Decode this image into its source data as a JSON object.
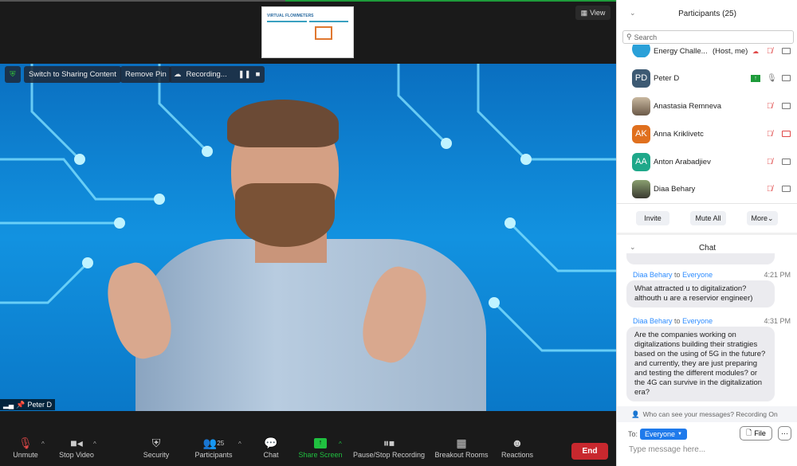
{
  "share_thumbnail": {
    "title": "VIRTUAL FLOWMETERS"
  },
  "view_button": "View",
  "video_overlay": {
    "switch_label": "Switch to Sharing Content",
    "remove_pin_label": "Remove Pin",
    "recording_label": "Recording...",
    "pause_icon": "pause-icon",
    "stop_icon": "stop-icon"
  },
  "active_speaker": {
    "name": "Peter D"
  },
  "toolbar": {
    "unmute": "Unmute",
    "stop_video": "Stop Video",
    "security": "Security",
    "participants": "Participants",
    "participants_count": "25",
    "chat": "Chat",
    "share_screen": "Share Screen",
    "recording": "Pause/Stop Recording",
    "breakout": "Breakout Rooms",
    "reactions": "Reactions",
    "end": "End"
  },
  "participants_panel": {
    "title": "Participants (25)",
    "search_placeholder": "Search",
    "items": [
      {
        "name": "Energy Challe...",
        "role": "(Host, me)",
        "mic": "muted",
        "video": "on",
        "avatar": "logo"
      },
      {
        "name": "Peter D",
        "initials": "PD",
        "mic": "on",
        "video": "on",
        "sharing": true,
        "color": "#3d5a73"
      },
      {
        "name": "Anastasia Remneva",
        "mic": "muted",
        "video": "on",
        "avatar": "photo"
      },
      {
        "name": "Anna Kriklivetc",
        "initials": "AK",
        "mic": "muted",
        "video": "off",
        "color": "#e0701e"
      },
      {
        "name": "Anton Arabadjiev",
        "initials": "AA",
        "mic": "muted",
        "video": "on",
        "color": "#1fa88a"
      },
      {
        "name": "Diaa Behary",
        "mic": "muted",
        "video": "on",
        "avatar": "photo"
      }
    ],
    "invite": "Invite",
    "mute_all": "Mute All",
    "more": "More"
  },
  "chat_panel": {
    "title": "Chat",
    "messages": [
      {
        "sender": "Diaa Behary",
        "to_word": "to",
        "recipient": "Everyone",
        "time": "4:21 PM",
        "text": "What attracted u to digitalization? althouth u are a reservior engineer)"
      },
      {
        "sender": "Diaa Behary",
        "to_word": "to",
        "recipient": "Everyone",
        "time": "4:31 PM",
        "text": "Are the companies working on digitalizations building their stratigies based on the using of 5G in the future? and currently, they are just preparing and testing the different modules? or the 4G can survive in the digitalization era?"
      }
    ],
    "visibility_note": "Who can see your messages? Recording On",
    "to_label": "To:",
    "recipient": "Everyone",
    "file_label": "File",
    "more_label": "···",
    "input_placeholder": "Type message here..."
  },
  "colors": {
    "accent": "#2d8cff",
    "end": "#c8282e",
    "muted": "#e04848",
    "share": "#20c040"
  }
}
